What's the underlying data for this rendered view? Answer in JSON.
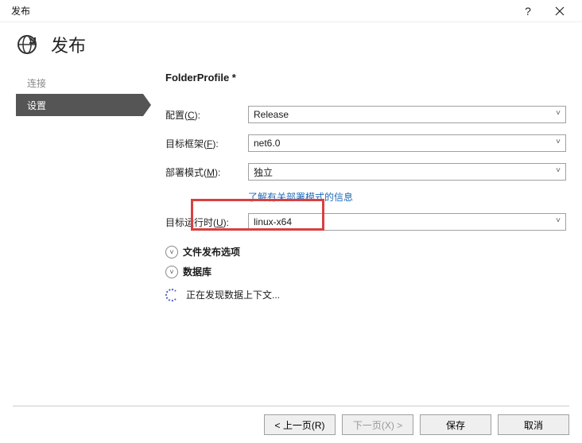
{
  "window": {
    "title": "发布",
    "help_glyph": "?",
    "close_label": "Close"
  },
  "header": {
    "title": "发布",
    "icon_name": "globe-arrow-icon"
  },
  "sidebar": {
    "items": [
      {
        "label": "连接",
        "active": false
      },
      {
        "label": "设置",
        "active": true
      }
    ]
  },
  "main": {
    "profile_name": "FolderProfile *",
    "fields": {
      "configuration": {
        "label_prefix": "配置(",
        "hotkey": "C",
        "label_suffix": "):",
        "value": "Release"
      },
      "target_framework": {
        "label_prefix": "目标框架(",
        "hotkey": "F",
        "label_suffix": "):",
        "value": "net6.0"
      },
      "deployment_mode": {
        "label_prefix": "部署模式(",
        "hotkey": "M",
        "label_suffix": "):",
        "value": "独立"
      },
      "deployment_link": "了解有关部署模式的信息",
      "target_runtime": {
        "label_prefix": "目标运行时(",
        "hotkey": "U",
        "label_suffix": "):",
        "value": "linux-x64"
      }
    },
    "expanders": {
      "file_publish": "文件发布选项",
      "database": "数据库"
    },
    "loading_text": "正在发现数据上下文..."
  },
  "footer": {
    "prev": "< 上一页(R)",
    "next": "下一页(X) >",
    "save": "保存",
    "cancel": "取消"
  }
}
